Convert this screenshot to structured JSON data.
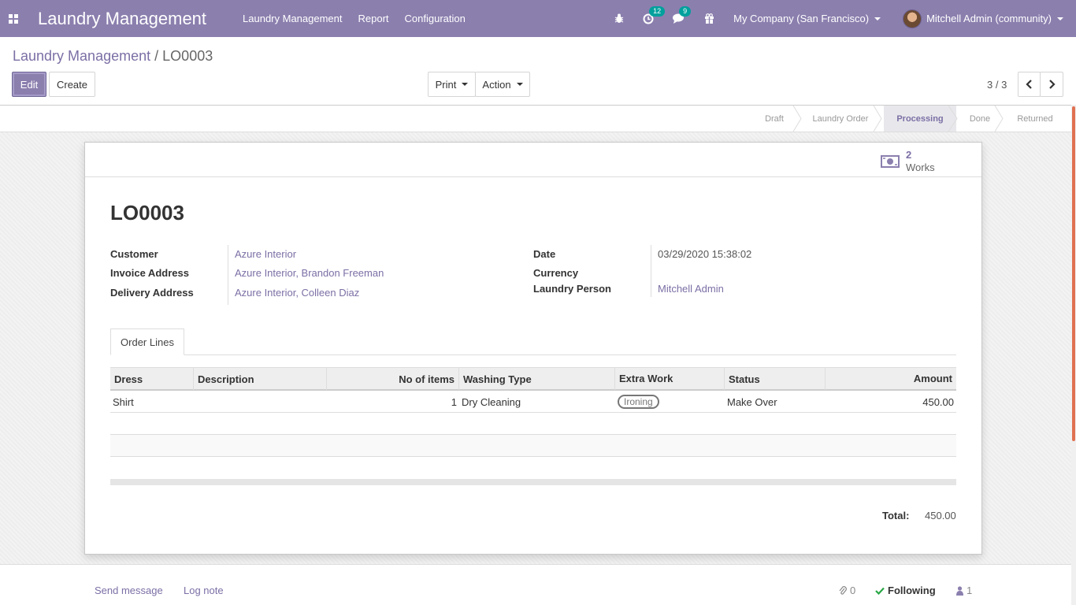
{
  "navbar": {
    "brand": "Laundry Management",
    "menu": [
      "Laundry Management",
      "Report",
      "Configuration"
    ],
    "activity_count": "12",
    "message_count": "9",
    "company": "My Company (San Francisco)",
    "user": "Mitchell Admin (community)"
  },
  "breadcrumb": {
    "parent": "Laundry Management",
    "separator": "/",
    "current": "LO0003"
  },
  "controls": {
    "edit": "Edit",
    "create": "Create",
    "print": "Print",
    "action": "Action",
    "pager": "3 / 3"
  },
  "statusbar": {
    "stages": [
      "Draft",
      "Laundry Order",
      "Processing",
      "Done",
      "Returned"
    ],
    "active": "Processing"
  },
  "smart_button": {
    "count": "2",
    "label": "Works"
  },
  "record": {
    "name": "LO0003",
    "customer_label": "Customer",
    "customer": "Azure Interior",
    "invoice_label": "Invoice Address",
    "invoice": "Azure Interior, Brandon Freeman",
    "delivery_label": "Delivery Address",
    "delivery": "Azure Interior, Colleen Diaz",
    "date_label": "Date",
    "date": "03/29/2020 15:38:02",
    "currency_label": "Currency",
    "currency": "",
    "person_label": "Laundry Person",
    "person": "Mitchell Admin"
  },
  "tab": {
    "label": "Order Lines"
  },
  "table": {
    "headers": [
      "Dress",
      "Description",
      "No of items",
      "Washing Type",
      "Extra Work",
      "Status",
      "Amount"
    ],
    "rows": [
      {
        "dress": "Shirt",
        "description": "",
        "items": "1",
        "washing": "Dry Cleaning",
        "extra": "Ironing",
        "status": "Make Over",
        "amount": "450.00"
      }
    ]
  },
  "total": {
    "label": "Total:",
    "value": "450.00"
  },
  "chatter": {
    "send": "Send message",
    "log": "Log note",
    "attachments": "0",
    "following": "Following",
    "followers": "1"
  },
  "colors": {
    "primary": "#8b7fae",
    "link": "#7c6fa5",
    "badge": "#00a09d"
  }
}
